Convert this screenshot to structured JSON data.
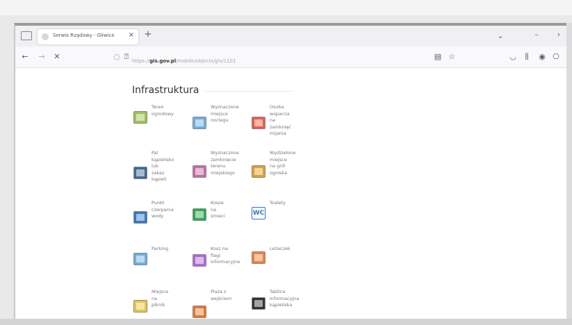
{
  "browser": {
    "tab_title": "Serwis Rządowy - Gliwice",
    "tab_close_glyph": "×",
    "new_tab_glyph": "+",
    "address_prefix": "https://",
    "address_domain": "gis.gov.pl",
    "address_path": "/mobile/objects/gis/1101",
    "toolbar_icons": [
      "sidebar-icon",
      "back-icon",
      "forward-icon",
      "reload-icon",
      "shield-icon",
      "lock-icon",
      "reader-icon",
      "star-icon",
      "pocket-icon",
      "downloads-icon",
      "account-icon",
      "extensions-icon",
      "list-all-tabs-icon",
      "minimize-icon",
      "close-window-icon"
    ]
  },
  "page": {
    "heading": "Infrastruktura",
    "items": [
      {
        "label": "Teren\nogrodowy",
        "icon": "garden-icon",
        "color": "#9ec24f"
      },
      {
        "label": "Wyznaczone\nmiejsce\nnoclegu",
        "icon": "sleeping-place-icon",
        "color": "#6ab0e0"
      },
      {
        "label": "Osoba\nwsparcia\nna\nzamknięć\nmijania",
        "icon": "support-person-icon",
        "color": "#e85c4a"
      },
      {
        "label": "Pal\nkąpielisko\nlub\nzakaz\nkąpieli",
        "icon": "swimming-icon",
        "color": "#3f6a99"
      },
      {
        "label": "Wyznaczone\nzamknięcie\nterenu\nmiejskiego",
        "icon": "enclosure-icon",
        "color": "#c86aa8"
      },
      {
        "label": "Wydzielone\nmiejsce\nna grill\nogniska",
        "icon": "grill-icon",
        "color": "#e0a030"
      },
      {
        "label": "Punkt\nczerpania\nwody",
        "icon": "water-tap-icon",
        "color": "#3478c8"
      },
      {
        "label": "Kosze\nna\nśmieci",
        "icon": "trash-bin-icon",
        "color": "#2fa84f"
      },
      {
        "label": "Toalety",
        "icon": "toilet-wc-icon",
        "color": "#2a73c9"
      },
      {
        "label": "Parking",
        "icon": "parking-icon",
        "color": "#6ab0e0"
      },
      {
        "label": "Kosz na\nflagi\ninformacyjne",
        "icon": "notice-board-icon",
        "color": "#b06ad8"
      },
      {
        "label": "Leżaczek",
        "icon": "deckchair-icon",
        "color": "#f08040"
      },
      {
        "label": "Miejsce\nna\npiknik",
        "icon": "picnic-icon",
        "color": "#e8c840"
      },
      {
        "label": "Plaża z\nwejściem",
        "icon": "beach-icon",
        "color": "#e07a30"
      },
      {
        "label": "Tablica\ninformacyjna\nkąpieliska",
        "icon": "info-board-icon",
        "color": "#333333"
      }
    ]
  }
}
